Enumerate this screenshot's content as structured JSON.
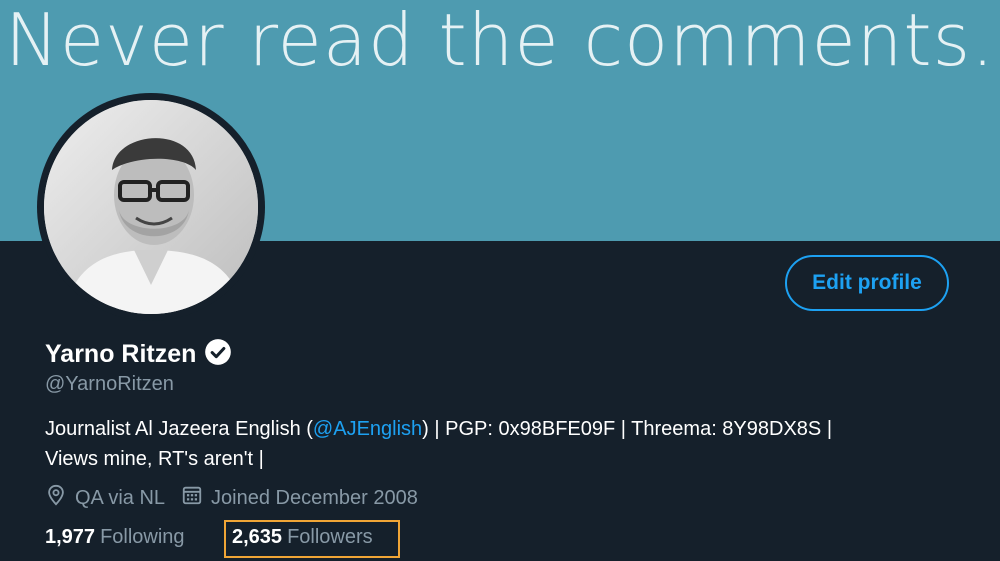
{
  "banner": {
    "text": "Never read the comments."
  },
  "profile": {
    "name": "Yarno Ritzen",
    "handle": "@YarnoRitzen",
    "bio_part1": "Journalist Al Jazeera English (",
    "bio_mention": "@AJEnglish",
    "bio_part2": ") | PGP: 0x98BFE09F | Threema: 8Y98DX8S |",
    "bio_line2": "Views mine, RT's aren't |",
    "location": "QA via NL",
    "joined": "Joined December 2008",
    "following_count": "1,977",
    "following_label": "Following",
    "followers_count": "2,635",
    "followers_label": "Followers"
  },
  "actions": {
    "edit_profile": "Edit profile"
  },
  "colors": {
    "accent": "#1da1f2",
    "highlight": "#f0a536",
    "banner": "#4e9bb0",
    "background": "#15202b"
  }
}
